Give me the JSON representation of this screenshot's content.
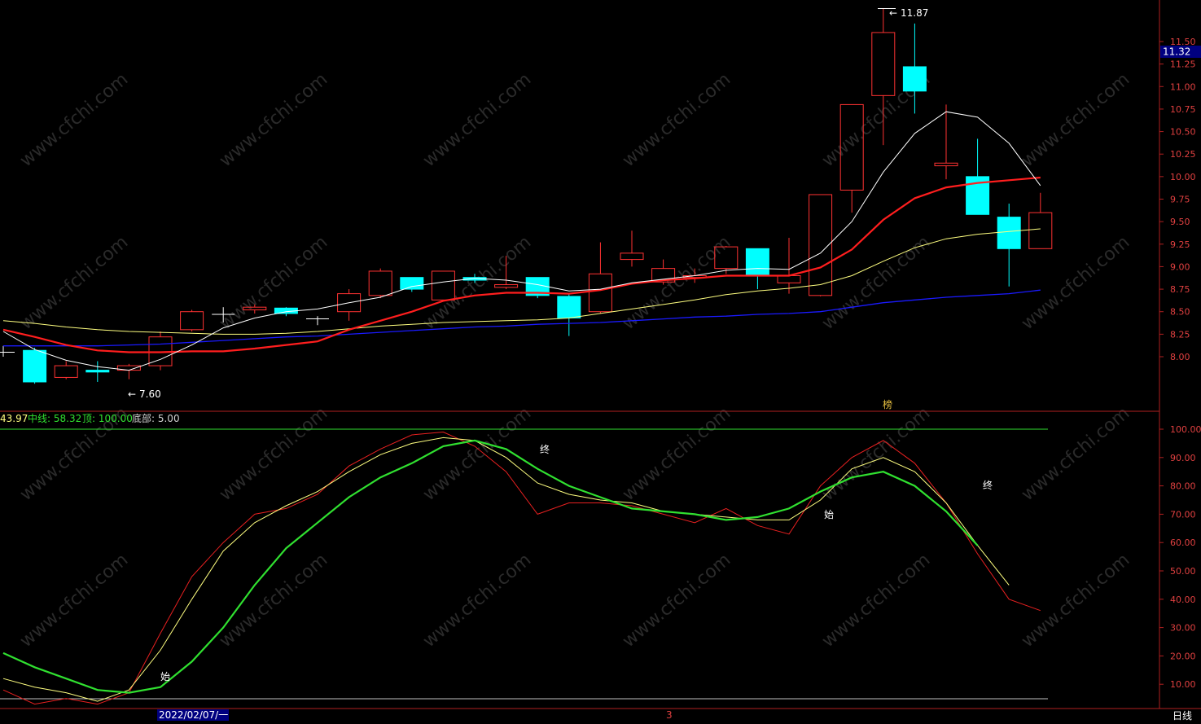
{
  "price_panel": {
    "axis_ticks": [
      "11.50",
      "11.25",
      "11.00",
      "10.75",
      "10.50",
      "10.25",
      "10.00",
      "9.75",
      "9.50",
      "9.25",
      "9.00",
      "8.75",
      "8.50",
      "8.25",
      "8.00"
    ],
    "current_price": "11.32",
    "high_label": "11.87",
    "low_label": "7.60",
    "marker_char": "榜"
  },
  "indicator_panel": {
    "header_value": "43.97",
    "mid_label": "中线: 58.32",
    "top_label": "顶: 100.00",
    "bottom_label": "底部: 5.00",
    "axis_ticks": [
      "100.00",
      "90.00",
      "80.00",
      "70.00",
      "60.00",
      "50.00",
      "40.00",
      "30.00",
      "20.00",
      "10.00"
    ],
    "start_char": "始",
    "end_char": "终"
  },
  "footer": {
    "date_label": "2022/02/07/一",
    "month_label": "3",
    "period_label": "日线"
  },
  "watermark": "www.cfchi.com",
  "colors": {
    "up": "#ff3232",
    "down": "#00ffff",
    "ma_white": "#ffffff",
    "ma_red": "#ff1e1e",
    "ma_yellow": "#ffff80",
    "ma_blue": "#1a1aff",
    "k_red": "#e82020",
    "d_yellow": "#ffff80",
    "j_green": "#30e030"
  },
  "chart_data": [
    {
      "type": "candlestick",
      "ylim": [
        7.4,
        11.9
      ],
      "candles": [
        {
          "o": 8.05,
          "c": 8.05,
          "h": 8.12,
          "l": 8.0
        },
        {
          "o": 8.07,
          "c": 7.72,
          "h": 8.1,
          "l": 7.7
        },
        {
          "o": 7.77,
          "c": 7.9,
          "h": 7.95,
          "l": 7.75
        },
        {
          "o": 7.85,
          "c": 7.83,
          "h": 7.95,
          "l": 7.72
        },
        {
          "o": 7.85,
          "c": 7.9,
          "h": 7.92,
          "l": 7.75
        },
        {
          "o": 7.9,
          "c": 8.22,
          "h": 8.28,
          "l": 7.85
        },
        {
          "o": 8.3,
          "c": 8.5,
          "h": 8.52,
          "l": 8.28
        },
        {
          "o": 8.47,
          "c": 8.47,
          "h": 8.55,
          "l": 8.38
        },
        {
          "o": 8.52,
          "c": 8.55,
          "h": 8.58,
          "l": 8.48
        },
        {
          "o": 8.54,
          "c": 8.48,
          "h": 8.55,
          "l": 8.45
        },
        {
          "o": 8.42,
          "c": 8.42,
          "h": 8.45,
          "l": 8.35
        },
        {
          "o": 8.5,
          "c": 8.7,
          "h": 8.75,
          "l": 8.4
        },
        {
          "o": 8.68,
          "c": 8.95,
          "h": 8.98,
          "l": 8.65
        },
        {
          "o": 8.88,
          "c": 8.75,
          "h": 8.88,
          "l": 8.72
        },
        {
          "o": 8.63,
          "c": 8.95,
          "h": 8.95,
          "l": 8.62
        },
        {
          "o": 8.88,
          "c": 8.85,
          "h": 8.92,
          "l": 8.82
        },
        {
          "o": 8.77,
          "c": 8.8,
          "h": 9.12,
          "l": 8.75
        },
        {
          "o": 8.88,
          "c": 8.68,
          "h": 8.88,
          "l": 8.65
        },
        {
          "o": 8.67,
          "c": 8.43,
          "h": 8.7,
          "l": 8.23
        },
        {
          "o": 8.5,
          "c": 8.92,
          "h": 9.27,
          "l": 8.48
        },
        {
          "o": 9.08,
          "c": 9.15,
          "h": 9.4,
          "l": 9.0
        },
        {
          "o": 8.83,
          "c": 8.98,
          "h": 9.08,
          "l": 8.8
        },
        {
          "o": 8.88,
          "c": 8.9,
          "h": 8.98,
          "l": 8.82
        },
        {
          "o": 8.98,
          "c": 9.22,
          "h": 9.23,
          "l": 8.92
        },
        {
          "o": 9.2,
          "c": 8.9,
          "h": 9.2,
          "l": 8.75
        },
        {
          "o": 8.82,
          "c": 8.9,
          "h": 9.32,
          "l": 8.7
        },
        {
          "o": 8.68,
          "c": 9.8,
          "h": 9.8,
          "l": 8.67
        },
        {
          "o": 9.85,
          "c": 10.8,
          "h": 10.8,
          "l": 9.6
        },
        {
          "o": 10.9,
          "c": 11.6,
          "h": 11.87,
          "l": 10.35
        },
        {
          "o": 11.22,
          "c": 10.95,
          "h": 11.7,
          "l": 10.7
        },
        {
          "o": 10.12,
          "c": 10.15,
          "h": 10.8,
          "l": 9.97
        },
        {
          "o": 10.0,
          "c": 9.58,
          "h": 10.42,
          "l": 9.58
        },
        {
          "o": 9.55,
          "c": 9.2,
          "h": 9.7,
          "l": 8.78
        },
        {
          "o": 9.2,
          "c": 9.6,
          "h": 9.82,
          "l": 9.2
        }
      ],
      "ma_white": [
        8.28,
        8.08,
        7.96,
        7.89,
        7.85,
        7.97,
        8.13,
        8.32,
        8.43,
        8.5,
        8.53,
        8.6,
        8.66,
        8.78,
        8.83,
        8.87,
        8.85,
        8.8,
        8.73,
        8.75,
        8.82,
        8.86,
        8.9,
        8.96,
        8.98,
        8.97,
        9.15,
        9.5,
        10.05,
        10.48,
        10.72,
        10.66,
        10.37,
        9.9
      ],
      "ma_red": [
        8.3,
        8.22,
        8.13,
        8.07,
        8.05,
        8.05,
        8.06,
        8.06,
        8.09,
        8.13,
        8.17,
        8.3,
        8.4,
        8.5,
        8.62,
        8.68,
        8.71,
        8.71,
        8.7,
        8.74,
        8.81,
        8.85,
        8.87,
        8.9,
        8.9,
        8.9,
        8.99,
        9.19,
        9.52,
        9.76,
        9.88,
        9.93,
        9.96,
        9.99
      ],
      "ma_yellow": [
        8.4,
        8.37,
        8.33,
        8.3,
        8.28,
        8.27,
        8.26,
        8.25,
        8.25,
        8.26,
        8.28,
        8.31,
        8.34,
        8.36,
        8.38,
        8.39,
        8.4,
        8.41,
        8.43,
        8.48,
        8.53,
        8.58,
        8.63,
        8.69,
        8.73,
        8.76,
        8.8,
        8.9,
        9.06,
        9.21,
        9.31,
        9.36,
        9.39,
        9.42
      ],
      "ma_blue": [
        8.12,
        8.12,
        8.12,
        8.12,
        8.13,
        8.14,
        8.16,
        8.18,
        8.2,
        8.22,
        8.23,
        8.25,
        8.27,
        8.29,
        8.31,
        8.33,
        8.34,
        8.36,
        8.37,
        8.38,
        8.4,
        8.42,
        8.44,
        8.45,
        8.47,
        8.48,
        8.5,
        8.55,
        8.6,
        8.63,
        8.66,
        8.68,
        8.7,
        8.74
      ]
    },
    {
      "type": "line",
      "ylim": [
        0,
        105
      ],
      "series": [
        {
          "values": [
            8,
            3,
            5,
            3,
            7,
            28,
            48,
            60,
            70,
            72,
            77,
            87,
            93,
            98,
            99,
            94,
            85,
            70,
            74,
            74,
            73,
            70,
            67,
            72,
            66,
            63,
            80,
            90,
            96,
            88,
            74,
            56,
            40,
            36
          ]
        },
        {
          "values": [
            12,
            9,
            7,
            4,
            8,
            22,
            40,
            57,
            67,
            73,
            78,
            85,
            91,
            95,
            97,
            96,
            90,
            81,
            77,
            75,
            74,
            71,
            70,
            69,
            68,
            68,
            75,
            86,
            90,
            85,
            74,
            59,
            45
          ]
        },
        {
          "values": [
            21,
            16,
            12,
            8,
            7,
            9,
            18,
            30,
            45,
            58,
            67,
            76,
            83,
            88,
            94,
            96,
            93,
            86,
            80,
            76,
            72,
            71,
            70,
            68,
            69,
            72,
            78,
            83,
            85,
            80,
            71,
            59
          ]
        }
      ]
    }
  ]
}
